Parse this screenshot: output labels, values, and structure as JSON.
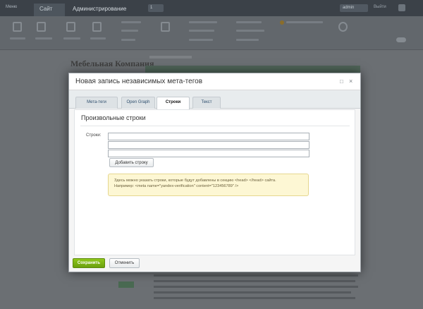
{
  "background": {
    "menu_label": "Меню",
    "tab_site": "Сайт",
    "tab_admin": "Администрирование",
    "notification_count": "1",
    "user_name": "admin",
    "exit_label": "Выйти",
    "company_logo": "Мебельная Компания"
  },
  "dialog": {
    "title": "Новая запись независимых мета-тегов",
    "tabs": [
      {
        "label": "Мета-теги",
        "active": false
      },
      {
        "label": "Open Graph",
        "active": false
      },
      {
        "label": "Строки",
        "active": true
      },
      {
        "label": "Текст",
        "active": false
      }
    ],
    "section_title": "Произвольные строки",
    "strings_label": "Строки:",
    "inputs": [
      {
        "value": "",
        "placeholder": ""
      },
      {
        "value": "",
        "placeholder": ""
      },
      {
        "value": "",
        "placeholder": ""
      }
    ],
    "add_row_button": "Добавить строку",
    "hint_line1": "Здесь можно указать строки, которые будут добавлены в секцию <head> </head> сайта.",
    "hint_line2": "Например: <meta name=\"yandex-verification\" content=\"123456789\" />",
    "save_button": "Сохранить",
    "cancel_button": "Отменить"
  },
  "colors": {
    "accent_green": "#7cb518",
    "hint_background": "#fdf7d4",
    "overlay": "#5a5d60"
  },
  "icons": {
    "expand": "expand-icon",
    "close": "close-icon"
  }
}
